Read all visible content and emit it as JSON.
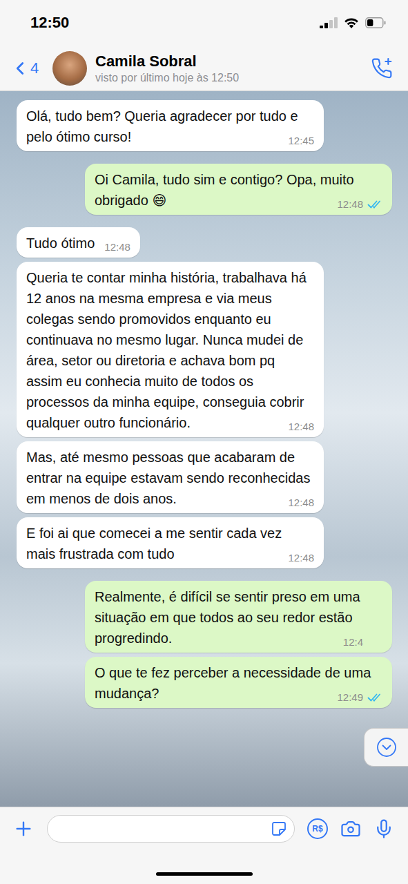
{
  "status_bar": {
    "time": "12:50",
    "signal": {
      "level": 0.5
    },
    "battery": {
      "level": 0.4
    }
  },
  "header": {
    "back_count": "4",
    "name": "Camila Sobral",
    "last_seen": "visto por último hoje às 12:50"
  },
  "messages": [
    {
      "kind": "incoming",
      "text": "Olá, tudo bem? Queria agradecer por tudo e pelo ótimo curso!",
      "time": "12:45",
      "read": false
    },
    {
      "kind": "outgoing",
      "text": "Oi Camila, tudo sim e contigo? Opa, muito obrigado 😄",
      "time": "12:48",
      "read": true
    },
    {
      "kind": "incoming",
      "text": "Tudo ótimo",
      "time": "12:48",
      "read": false
    },
    {
      "kind": "incoming",
      "text": "Queria te contar minha história, trabalhava há 12 anos na mesma empresa e via meus colegas sendo promovidos enquanto eu continuava no mesmo lugar. Nunca mudei de área, setor ou diretoria e achava bom pq assim eu conhecia muito de todos os processos da minha equipe, conseguia cobrir qualquer outro funcionário.",
      "time": "12:48",
      "read": false
    },
    {
      "kind": "incoming",
      "text": "Mas, até mesmo pessoas que acabaram de entrar na equipe estavam sendo reconhecidas em menos de dois anos.",
      "time": "12:48",
      "read": false
    },
    {
      "kind": "incoming",
      "text": "E foi ai que comecei a me sentir cada vez mais frustrada com tudo",
      "time": "12:48",
      "read": false
    },
    {
      "kind": "outgoing",
      "text": "Realmente, é difícil se sentir preso em uma situação em que todos ao seu redor estão progredindo.",
      "time": "12:4",
      "read": false
    },
    {
      "kind": "outgoing",
      "text": "O que te fez perceber a necessidade de uma mudança?",
      "time": "12:49",
      "read": true
    }
  ],
  "composer": {
    "payment_label": "R$"
  }
}
